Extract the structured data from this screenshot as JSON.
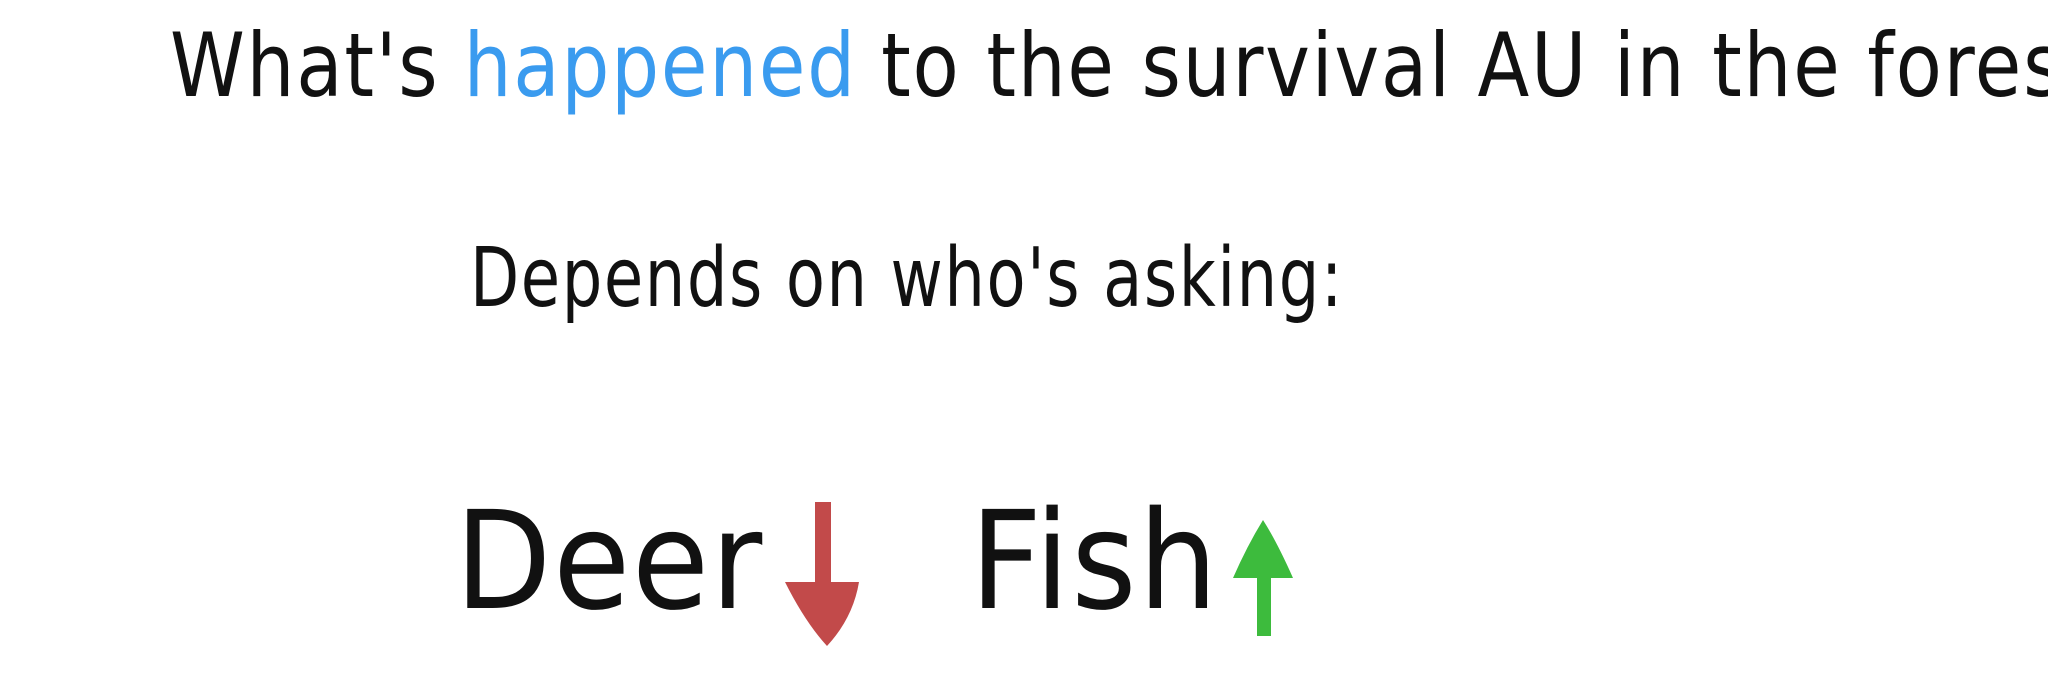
{
  "headline": {
    "parts": [
      "What's",
      "happened",
      "to the survival AU in the forest?"
    ],
    "accent_color": "#3a9bef"
  },
  "subline": {
    "text": "Depends on who's asking:"
  },
  "items": [
    {
      "label": "Deer",
      "direction": "down",
      "icon": "arrow-down-icon",
      "color": "#c24a4a"
    },
    {
      "label": "Fish",
      "direction": "up",
      "icon": "arrow-up-icon",
      "color": "#3dbb3d"
    }
  ]
}
